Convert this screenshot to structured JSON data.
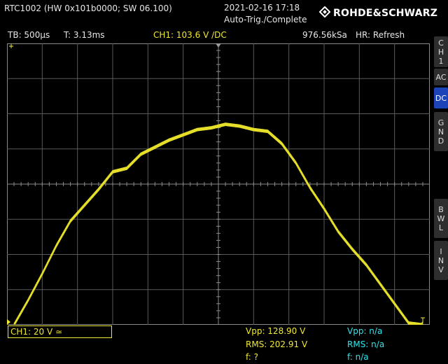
{
  "header": {
    "device": "RTC1002 (HW 0x101b0000; SW 06.100)",
    "datetime": "2021-02-16 17:18",
    "trigger_status": "Auto-Trig./Complete",
    "logo": "ROHDE&SCHWARZ"
  },
  "status_bar": {
    "timebase": "TB: 500µs",
    "trigger_time": "T: 3.13ms",
    "trigger_level": "CH1: 103.6 V ∕DC",
    "sample_rate": "976.56kSa",
    "acq_mode": "HR: Refresh"
  },
  "side_menu": {
    "channel": [
      "C",
      "H",
      "1"
    ],
    "ac": "AC",
    "dc": "DC",
    "gnd": [
      "G",
      "N",
      "D"
    ],
    "bwl": [
      "B",
      "W",
      "L"
    ],
    "inv": [
      "I",
      "N",
      "V"
    ]
  },
  "channel_box": "CH1: 20 V ≃",
  "measurements": {
    "col1": [
      "Vpp: 128.90 V",
      "RMS: 202.91 V",
      "f: ?"
    ],
    "col2": [
      "Vpp: n/a",
      "RMS: n/a",
      "f: n/a"
    ]
  },
  "colors": {
    "trace": "#e6df2a",
    "grid": "#5a5a5a",
    "channel": "#f0e832",
    "cyan": "#2ee6ee",
    "active_button": "#1c44b8"
  },
  "chart_data": {
    "type": "line",
    "title": "",
    "xlabel": "",
    "ylabel": "",
    "x_divisions": 12,
    "y_divisions": 8,
    "xlim": [
      0,
      12
    ],
    "ylim": [
      -4,
      4
    ],
    "series": [
      {
        "name": "",
        "x": [
          0.2,
          0.6,
          1.0,
          1.4,
          1.8,
          2.2,
          2.6,
          3.0,
          3.4,
          3.8,
          4.2,
          4.6,
          5.0,
          5.4,
          5.8,
          6.2,
          6.6,
          7.0,
          7.4,
          7.8,
          8.2,
          8.6,
          9.0,
          9.4,
          9.8,
          10.2,
          10.6,
          11.0,
          11.4,
          11.8
        ],
        "y": [
          -4.0,
          -3.3,
          -2.55,
          -1.75,
          -1.05,
          -0.6,
          -0.15,
          0.35,
          0.45,
          0.85,
          1.05,
          1.25,
          1.4,
          1.55,
          1.6,
          1.7,
          1.65,
          1.55,
          1.5,
          1.15,
          0.6,
          -0.1,
          -0.7,
          -1.35,
          -1.85,
          -2.3,
          -2.85,
          -3.4,
          -3.95,
          -4.0
        ]
      }
    ]
  }
}
